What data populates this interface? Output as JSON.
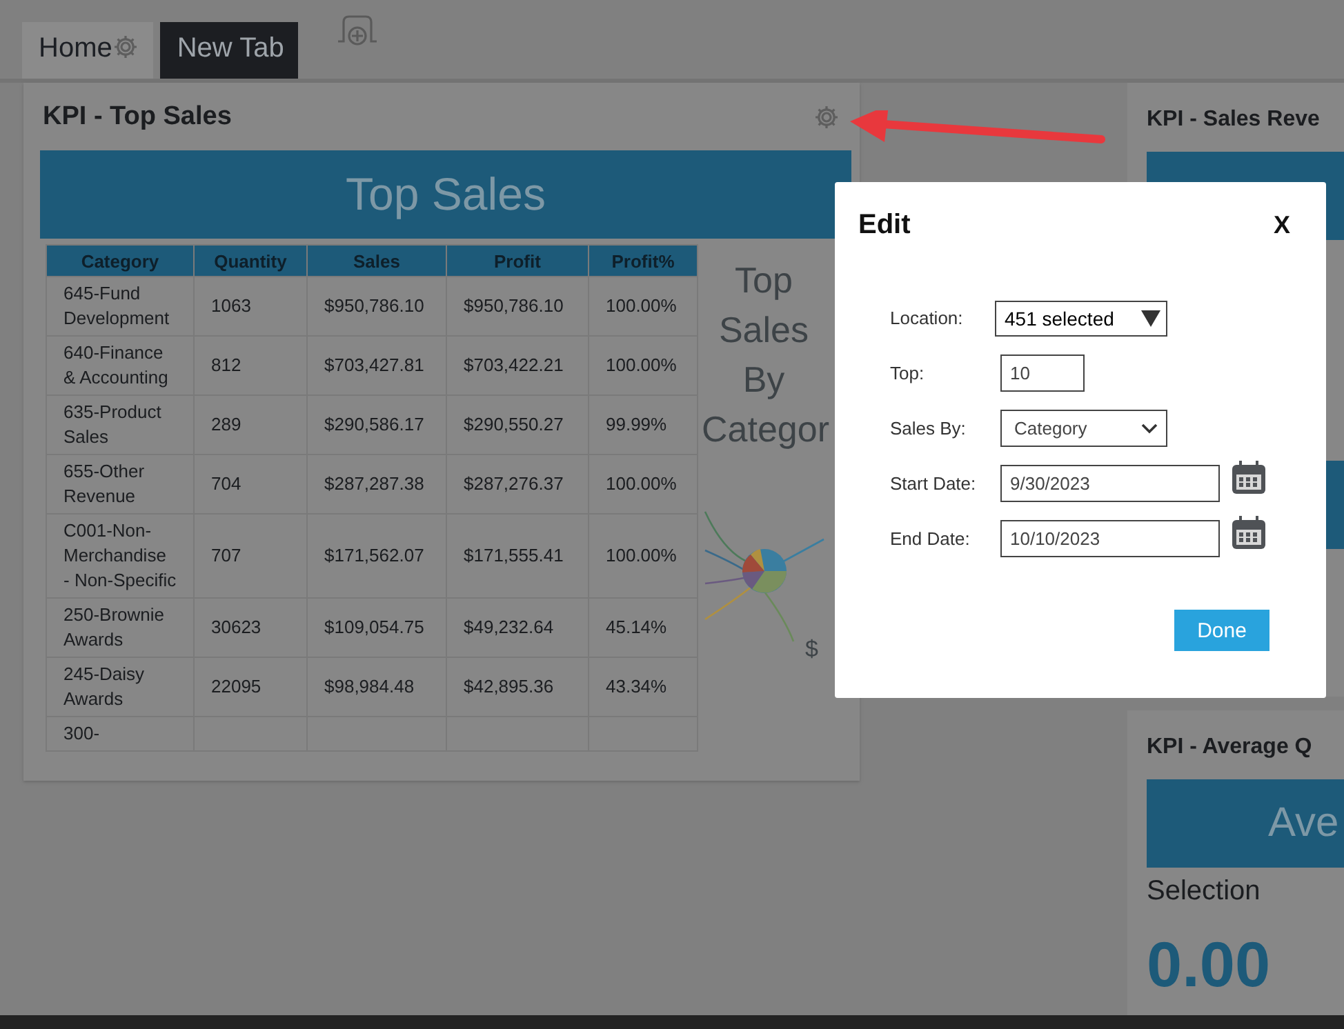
{
  "tabs": [
    {
      "label": "Home",
      "selected": true
    },
    {
      "label": "New Tab",
      "selected": false
    }
  ],
  "main_card": {
    "title": "KPI - Top Sales",
    "banner": "Top Sales",
    "table": {
      "columns": [
        "Category",
        "Quantity",
        "Sales",
        "Profit",
        "Profit%"
      ],
      "rows": [
        [
          "645-Fund Development",
          "1063",
          "$950,786.10",
          "$950,786.10",
          "100.00%"
        ],
        [
          "640-Finance & Accounting",
          "812",
          "$703,427.81",
          "$703,422.21",
          "100.00%"
        ],
        [
          "635-Product Sales",
          "289",
          "$290,586.17",
          "$290,550.27",
          "99.99%"
        ],
        [
          "655-Other Revenue",
          "704",
          "$287,287.38",
          "$287,276.37",
          "100.00%"
        ],
        [
          "C001-Non-Merchandise - Non-Specific",
          "707",
          "$171,562.07",
          "$171,555.41",
          "100.00%"
        ],
        [
          "250-Brownie Awards",
          "30623",
          "$109,054.75",
          "$49,232.64",
          "45.14%"
        ],
        [
          "245-Daisy Awards",
          "22095",
          "$98,984.48",
          "$42,895.36",
          "43.34%"
        ],
        [
          "300-"
        ]
      ]
    },
    "chart": {
      "title": "Top Sales By Categor",
      "axis_label": "$"
    }
  },
  "side_cards": [
    {
      "title": "KPI - Sales Reve"
    },
    {
      "title": "KPI - Average Q",
      "banner": "Ave",
      "label": "Selection",
      "value": "0.00"
    }
  ],
  "dialog": {
    "title": "Edit",
    "close": "X",
    "fields": [
      {
        "kind": "multiselect",
        "label": "Location:",
        "value": "451 selected"
      },
      {
        "kind": "text",
        "label": "Top:",
        "value": "10"
      },
      {
        "kind": "select",
        "label": "Sales By:",
        "value": "Category"
      },
      {
        "kind": "date",
        "label": "Start Date:",
        "value": "9/30/2023"
      },
      {
        "kind": "date",
        "label": "End Date:",
        "value": "10/10/2023"
      }
    ],
    "button": "Done"
  }
}
